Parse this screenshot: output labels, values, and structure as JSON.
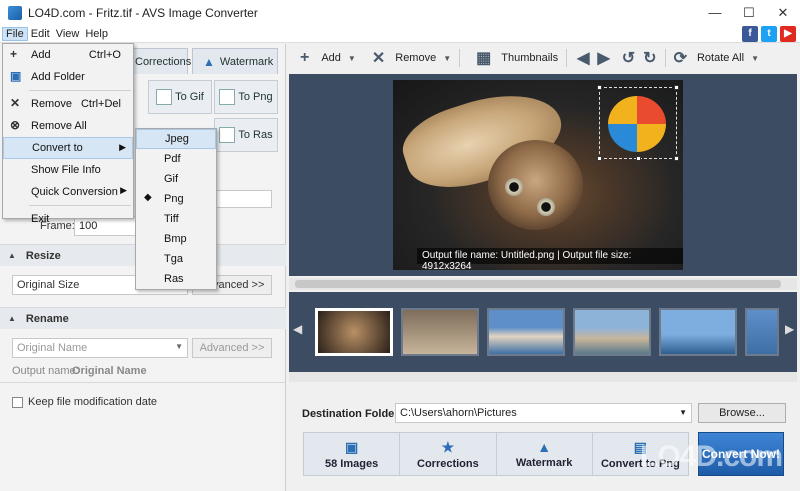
{
  "window": {
    "title": "LO4D.com - Fritz.tif - AVS Image Converter",
    "controls": [
      "—",
      "☐",
      "✕"
    ]
  },
  "menubar": {
    "items": [
      "File",
      "Edit",
      "View",
      "Help"
    ]
  },
  "social": {
    "facebook": "f",
    "twitter": "t",
    "youtube": "▶"
  },
  "left": {
    "tabs": [
      "Corrections",
      "Watermark"
    ],
    "formats": [
      "To Gif",
      "To Png",
      "To Ras"
    ],
    "frame_label": "Frame:",
    "frame_value": "100",
    "resize": {
      "title": "Resize",
      "select": "Original Size",
      "advanced": "Advanced >>"
    },
    "rename": {
      "title": "Rename",
      "select_placeholder": "Original Name",
      "advanced": "Advanced >>",
      "output_label": "Output name:",
      "output_value": "Original Name"
    },
    "keep_date": "Keep file modification date"
  },
  "toolbar": {
    "add": "Add",
    "remove": "Remove",
    "thumbnails": "Thumbnails",
    "rotate": "Rotate All"
  },
  "preview": {
    "caption": "Output file name: Untitled.png | Output file size: 4912x3264"
  },
  "destination": {
    "label": "Destination Folder:",
    "path": "C:\\Users\\ahorn\\Pictures",
    "browse": "Browse..."
  },
  "steps": [
    {
      "label": "58 Images",
      "icon": "▣"
    },
    {
      "label": "Corrections",
      "icon": "★"
    },
    {
      "label": "Watermark",
      "icon": "▲"
    },
    {
      "label": "Convert to Png",
      "icon": "▤"
    }
  ],
  "convert_button": "Convert Now!",
  "watermark_text": "LO4D.com",
  "file_menu": [
    {
      "label": "Add",
      "shortcut": "Ctrl+O",
      "icon": "+"
    },
    {
      "label": "Add Folder",
      "shortcut": "",
      "icon": "▣"
    },
    {
      "label": "Remove",
      "shortcut": "Ctrl+Del",
      "icon": "✕"
    },
    {
      "label": "Remove All",
      "shortcut": "",
      "icon": "⊗"
    },
    {
      "label": "Convert to",
      "shortcut": "",
      "icon": ""
    },
    {
      "label": "Show File Info",
      "shortcut": "",
      "icon": ""
    },
    {
      "label": "Quick Conversion",
      "shortcut": "",
      "icon": ""
    },
    {
      "label": "Exit",
      "shortcut": "",
      "icon": ""
    }
  ],
  "convert_submenu": [
    "Jpeg",
    "Pdf",
    "Gif",
    "Png",
    "Tiff",
    "Bmp",
    "Tga",
    "Ras"
  ],
  "selected_format": "Png",
  "colors": {
    "accent": "#1d5ca8",
    "panel": "#3c4d63",
    "highlight": "#d7e6f4"
  }
}
